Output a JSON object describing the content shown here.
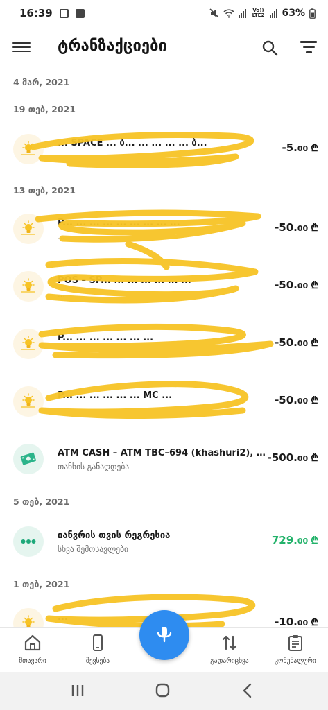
{
  "status_bar": {
    "time": "16:39",
    "network_label": "Vo)) LTE2",
    "battery": "63%"
  },
  "header": {
    "title": "ტრანზაქციები"
  },
  "dates": [
    {
      "label": "4 მარ, 2021"
    },
    {
      "label": "19 თებ, 2021"
    },
    {
      "label": "13 თებ, 2021"
    },
    {
      "label": "5 თებ, 2021"
    },
    {
      "label": "1 თებ, 2021"
    }
  ],
  "transactions": [
    {
      "title": "... SPACE ... ბ... ... ... ... ... ბ...",
      "subtitle": "",
      "amount_main": "-5.",
      "amount_cents": "00",
      "currency": "₾",
      "icon": "bulb-icon"
    },
    {
      "title": "P... ... ... ... ... ... ... ... ...",
      "subtitle": "...",
      "amount_main": "-50.",
      "amount_cents": "00",
      "currency": "₾",
      "icon": "bulb-icon"
    },
    {
      "title": "POS – SP... ... ... ... ... ... ...",
      "subtitle": "...",
      "amount_main": "-50.",
      "amount_cents": "00",
      "currency": "₾",
      "icon": "bulb-icon"
    },
    {
      "title": "P... ... ... ... ... ... ...",
      "subtitle": "",
      "amount_main": "-50.",
      "amount_cents": "00",
      "currency": "₾",
      "icon": "bulb-icon"
    },
    {
      "title": "P... ... ... ... ... ... MC ...",
      "subtitle": "",
      "amount_main": "-50.",
      "amount_cents": "00",
      "currency": "₾",
      "icon": "bulb-icon"
    },
    {
      "title": "ATM CASH – ATM TBC–694 (khashuri2), ბარათ...",
      "subtitle": "თანხის განაღდება",
      "amount_main": "-500.",
      "amount_cents": "00",
      "currency": "₾",
      "icon": "cash-icon"
    },
    {
      "title": "იანვრის თვის რეგრესია",
      "subtitle": "სხვა შემოსავლები",
      "amount_main": "729.",
      "amount_cents": "00",
      "currency": "₾",
      "icon": "dots-icon",
      "positive": true
    },
    {
      "title": "...",
      "subtitle": "",
      "amount_main": "-10.",
      "amount_cents": "00",
      "currency": "₾",
      "icon": "bulb-icon"
    }
  ],
  "bottom_nav": {
    "home": "მთავარი",
    "services": "შევსება",
    "transfers": "გადარიცხვა",
    "utilities": "კომუნალური"
  },
  "colors": {
    "accent": "#2e8cf0",
    "positive": "#22b26a",
    "scribble": "#f7c325",
    "bulb_bg": "#fdf5e3",
    "green_bg": "#e5f5ef"
  }
}
